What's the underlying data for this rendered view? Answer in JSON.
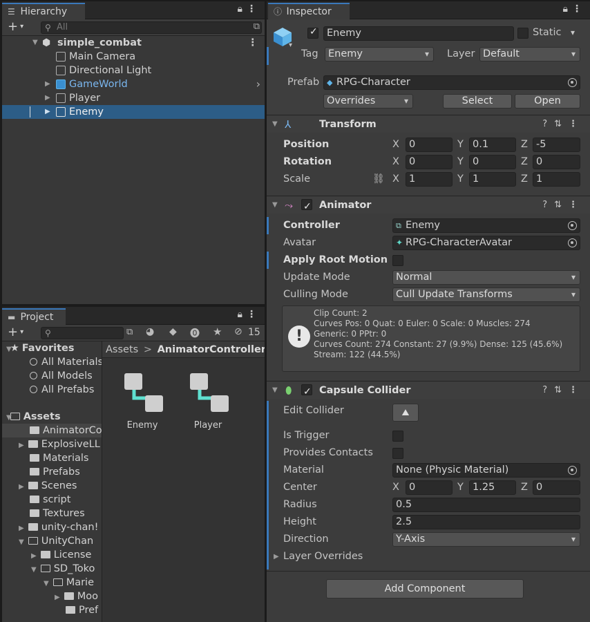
{
  "hierarchy": {
    "tab": "Hierarchy",
    "search_placeholder": "All",
    "scene": "simple_combat",
    "items": [
      "Main Camera",
      "Directional Light",
      "GameWorld",
      "Player",
      "Enemy"
    ]
  },
  "project": {
    "tab": "Project",
    "hidden_count": "15",
    "favorites_label": "Favorites",
    "favorites": [
      "All Materials",
      "All Models",
      "All Prefabs"
    ],
    "assets_label": "Assets",
    "tree": [
      "AnimatorCo",
      "ExplosiveLL",
      "Materials",
      "Prefabs",
      "Scenes",
      "script",
      "Textures",
      "unity-chan!",
      "UnityChan",
      "License",
      "SD_Toko",
      "Marie",
      "Moo",
      "Pref"
    ],
    "breadcrumb": {
      "root": "Assets",
      "sep": ">",
      "current": "AnimatorController"
    },
    "assets": [
      "Enemy",
      "Player"
    ]
  },
  "inspector": {
    "tab": "Inspector",
    "object_name": "Enemy",
    "static_label": "Static",
    "tag_label": "Tag",
    "tag_value": "Enemy",
    "layer_label": "Layer",
    "layer_value": "Default",
    "prefab_label": "Prefab",
    "prefab_value": "RPG-Character",
    "overrides_label": "Overrides",
    "select_label": "Select",
    "open_label": "Open",
    "transform": {
      "title": "Transform",
      "position_label": "Position",
      "position": [
        "0",
        "0.1",
        "-5"
      ],
      "rotation_label": "Rotation",
      "rotation": [
        "0",
        "0",
        "0"
      ],
      "scale_label": "Scale",
      "scale": [
        "1",
        "1",
        "1"
      ],
      "axes": [
        "X",
        "Y",
        "Z"
      ]
    },
    "animator": {
      "title": "Animator",
      "controller_label": "Controller",
      "controller_value": "Enemy",
      "avatar_label": "Avatar",
      "avatar_value": "RPG-CharacterAvatar",
      "root_motion_label": "Apply Root Motion",
      "update_mode_label": "Update Mode",
      "update_mode_value": "Normal",
      "culling_mode_label": "Culling Mode",
      "culling_mode_value": "Cull Update Transforms",
      "info": [
        "Clip Count: 2",
        "Curves Pos: 0 Quat: 0 Euler: 0 Scale: 0 Muscles: 274",
        "Generic: 0 PPtr: 0",
        "Curves Count: 274 Constant: 27 (9.9%) Dense: 125 (45.6%)",
        "Stream: 122 (44.5%)"
      ]
    },
    "capsule": {
      "title": "Capsule Collider",
      "edit_label": "Edit Collider",
      "trigger_label": "Is Trigger",
      "contacts_label": "Provides Contacts",
      "material_label": "Material",
      "material_value": "None (Physic Material)",
      "center_label": "Center",
      "center": [
        "0",
        "1.25",
        "0"
      ],
      "radius_label": "Radius",
      "radius_value": "0.5",
      "height_label": "Height",
      "height_value": "2.5",
      "direction_label": "Direction",
      "direction_value": "Y-Axis",
      "layer_overrides_label": "Layer Overrides"
    },
    "add_component_label": "Add Component"
  }
}
